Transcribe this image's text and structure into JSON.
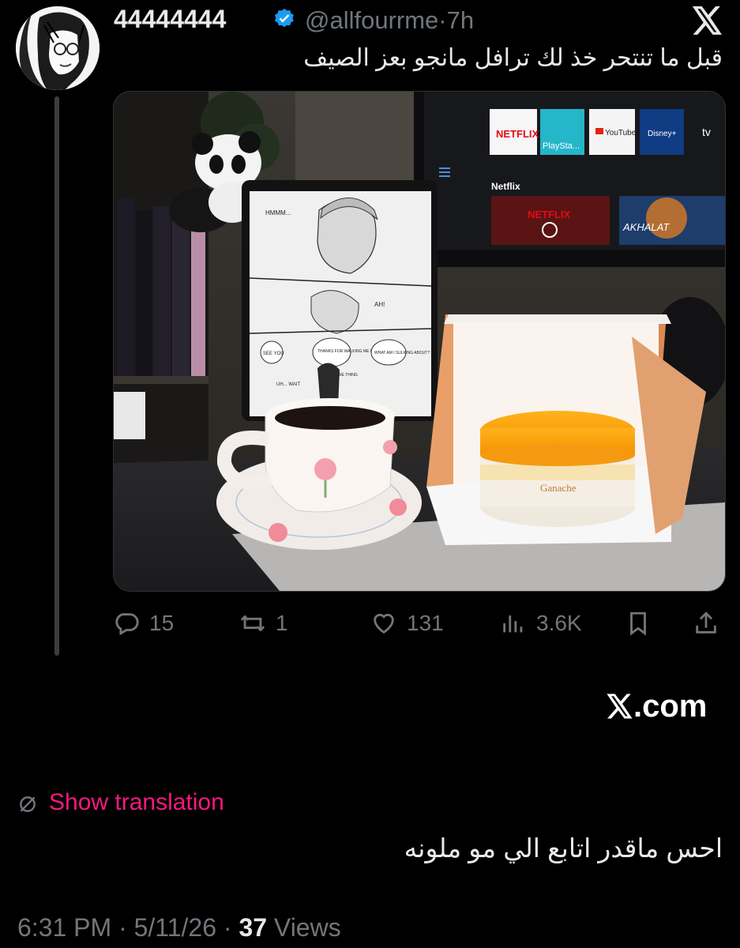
{
  "tweet": {
    "display_name": "44444444",
    "handle": "@allfourrme",
    "time_ago": "7h",
    "text": "قبل ما تنتحر خذ لك ترافل مانجو بعز الصيف",
    "photo_text": {
      "tv_row_label": "Netflix",
      "tiles": [
        "NETFLIX",
        "PlaySta...",
        "YouTube",
        "Disney+",
        "tv"
      ],
      "promo_1": "NETFLIX",
      "promo_2": "AKHALAT",
      "cake_brand": "Ganache",
      "manga_bubbles": [
        "HMMM...",
        "AH!",
        "SEE YOU",
        "THANKS FOR WALKING ME HOME",
        "SURE THING",
        "WHAT AM I SULKING ABOUT?",
        "UH... WAIT"
      ]
    },
    "stats": {
      "replies": "15",
      "reposts": "1",
      "likes": "131",
      "views": "3.6K"
    }
  },
  "footer": {
    "site": ".com",
    "show_translation": "Show translation",
    "reply_text": "احس ماقدر اتابع الي مو ملونه",
    "time": "6:31 PM",
    "date": "5/11/26",
    "views_count": "37",
    "views_label": "Views",
    "sep": "·"
  },
  "colors": {
    "background": "#000000",
    "text": "#e7e9ea",
    "muted": "#71767b",
    "verified": "#1d9bf0",
    "translation_link": "#f91880"
  }
}
